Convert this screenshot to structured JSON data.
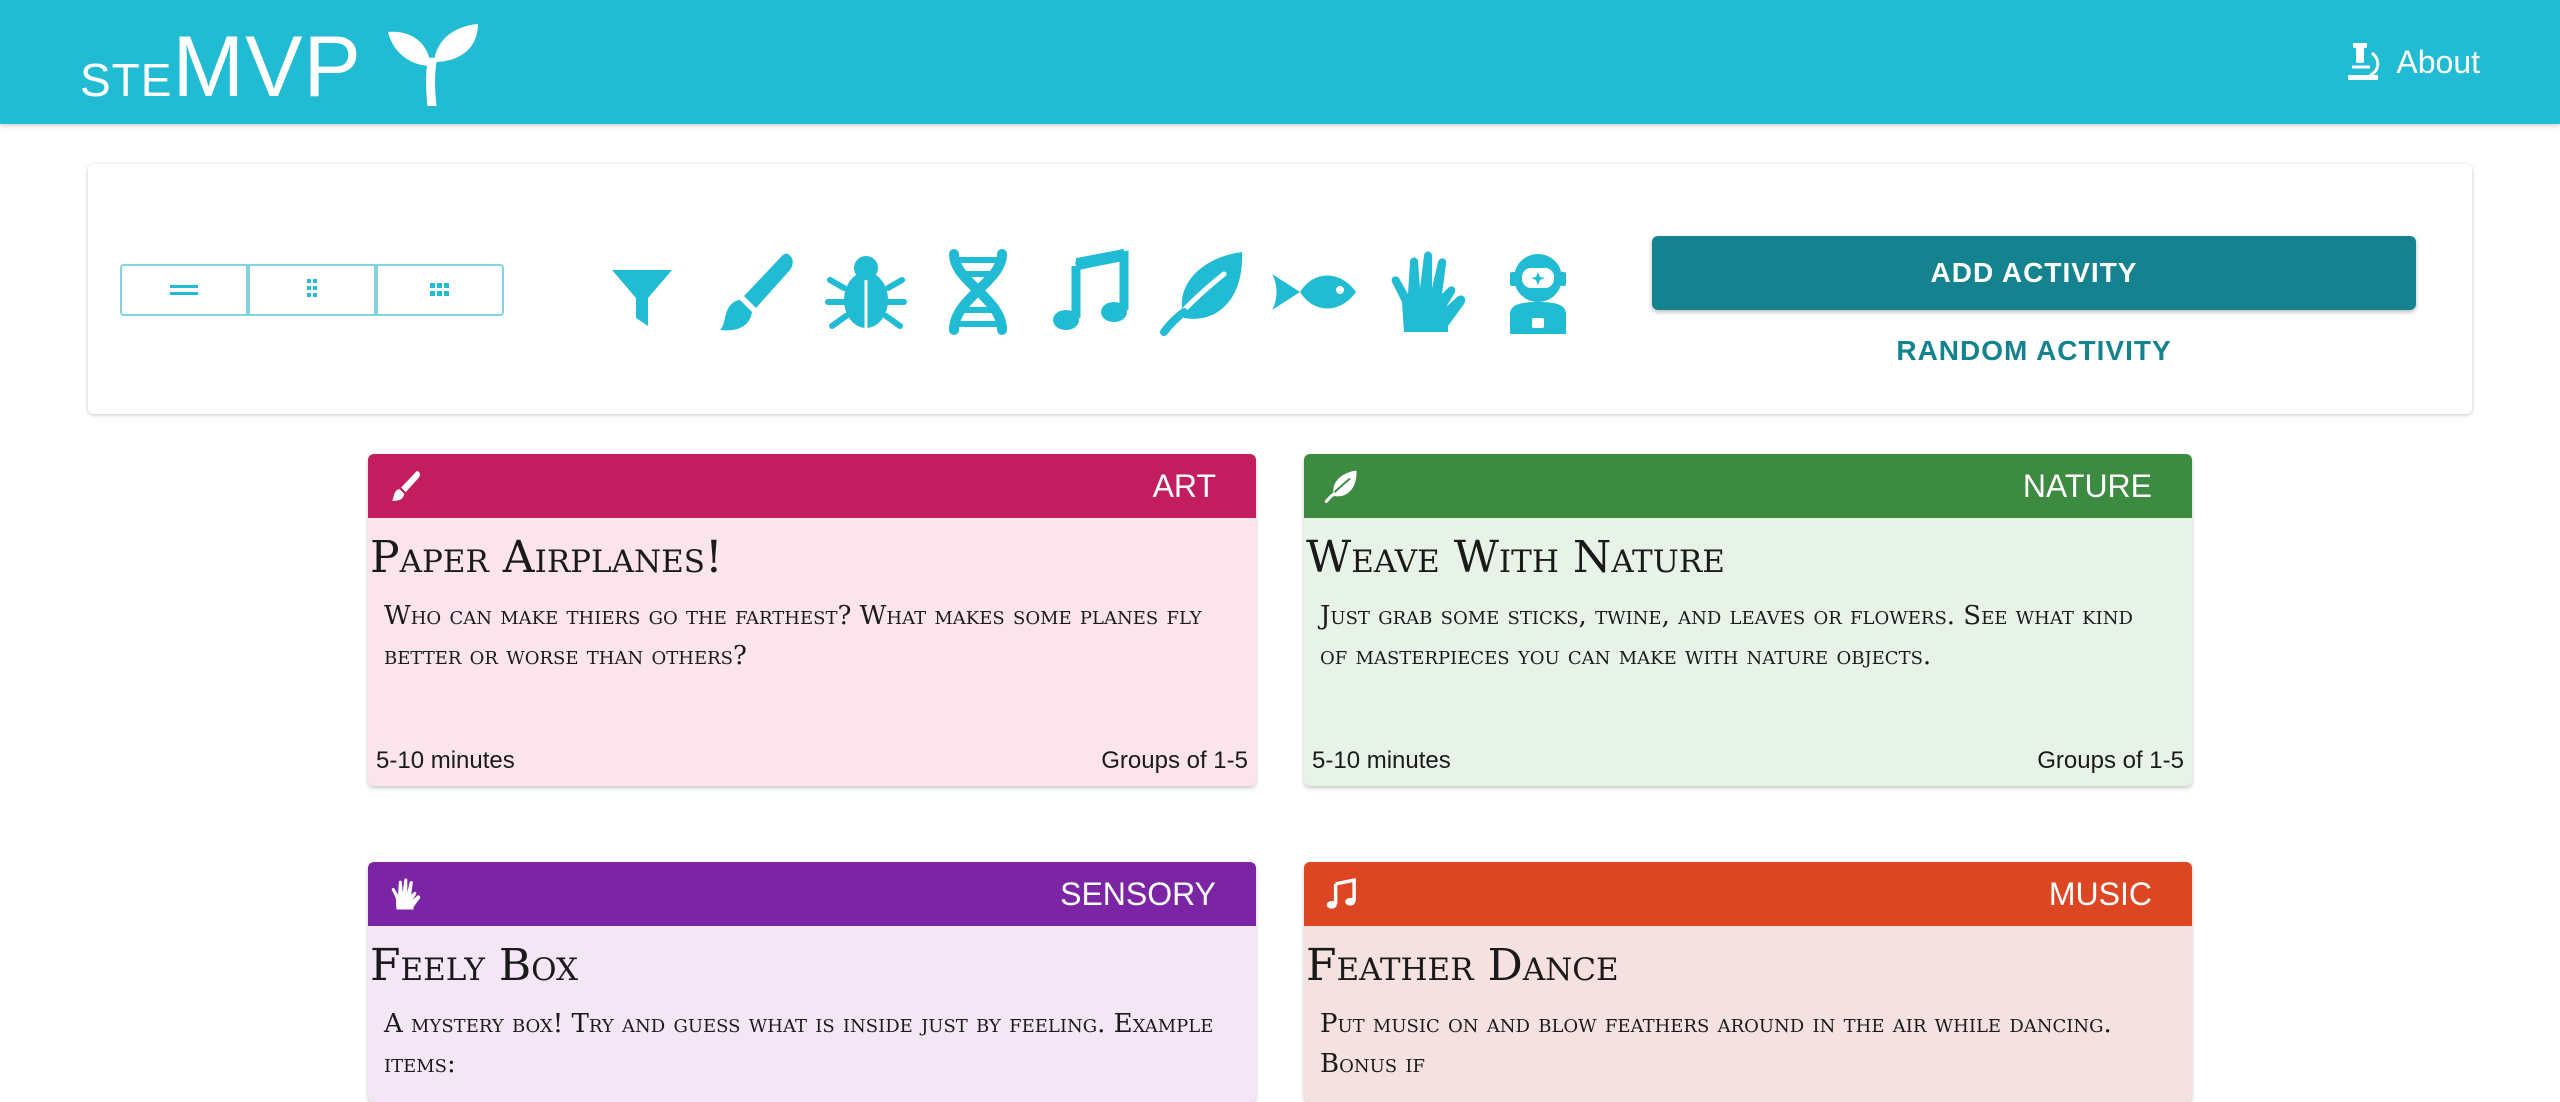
{
  "header": {
    "logo_small": "ste",
    "logo_big": "MVP",
    "about_label": "About"
  },
  "toolbar": {
    "view_toggles": [
      "list-view-icon",
      "two-column-view-icon",
      "grid-view-icon"
    ],
    "categories": [
      "filter-icon",
      "paint-brush-icon",
      "bug-icon",
      "dna-icon",
      "music-note-icon",
      "leaf-icon",
      "fish-icon",
      "hands-icon",
      "astronaut-icon"
    ],
    "add_label": "ADD ACTIVITY",
    "random_label": "RANDOM ACTIVITY"
  },
  "colors": {
    "appbar": "#22bbd4",
    "accent": "#14838f",
    "art": "#c21e5f",
    "art_bg": "#fbe4ec",
    "nature": "#3d8b40",
    "nature_bg": "#e8f3e8",
    "sensory": "#7b25a4",
    "sensory_bg": "#f3e6f5",
    "music": "#dd4622",
    "music_bg": "#f5e1df"
  },
  "activities": [
    {
      "category": "ART",
      "icon": "paint-brush-icon",
      "title": "Paper Airplanes!",
      "description": "Who can make thiers go the farthest? What makes some planes fly better or worse than others?",
      "duration": "5-10 minutes",
      "groups": "Groups of 1-5"
    },
    {
      "category": "NATURE",
      "icon": "leaf-icon",
      "title": "Weave With Nature",
      "description": "Just grab some sticks, twine, and leaves or flowers. See what kind of masterpieces you can make with nature objects.",
      "duration": "5-10 minutes",
      "groups": "Groups of 1-5"
    },
    {
      "category": "SENSORY",
      "icon": "hands-icon",
      "title": "Feely Box",
      "description": "A mystery box! Try and guess what is inside just by feeling. Example items:",
      "duration": "",
      "groups": ""
    },
    {
      "category": "MUSIC",
      "icon": "music-note-icon",
      "title": "Feather Dance",
      "description": "Put music on and blow feathers around in the air while dancing. Bonus if",
      "duration": "",
      "groups": ""
    }
  ]
}
